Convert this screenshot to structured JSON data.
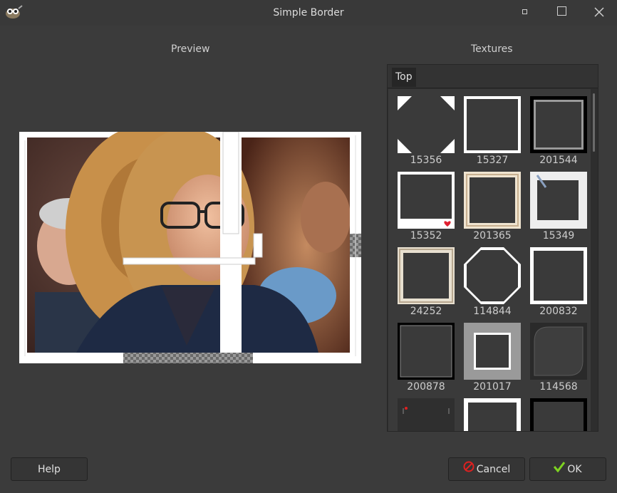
{
  "window": {
    "title": "Simple Border"
  },
  "labels": {
    "preview": "Preview",
    "textures": "Textures"
  },
  "tabs": [
    {
      "label": "Top"
    }
  ],
  "textures": [
    {
      "id": "15356"
    },
    {
      "id": "15327"
    },
    {
      "id": "201544"
    },
    {
      "id": "15352"
    },
    {
      "id": "201365"
    },
    {
      "id": "15349"
    },
    {
      "id": "24252"
    },
    {
      "id": "114844"
    },
    {
      "id": "200832"
    },
    {
      "id": "200878"
    },
    {
      "id": "201017"
    },
    {
      "id": "114568"
    },
    {
      "id": ""
    },
    {
      "id": ""
    },
    {
      "id": ""
    }
  ],
  "buttons": {
    "help": "Help",
    "cancel": "Cancel",
    "ok": "OK"
  },
  "colors": {
    "ok_check": "#7ed321",
    "cancel_icon": "#e02020"
  },
  "icons": {
    "app": "gimp-icon",
    "cancel": "cancel-icon",
    "ok": "checkmark-icon"
  }
}
